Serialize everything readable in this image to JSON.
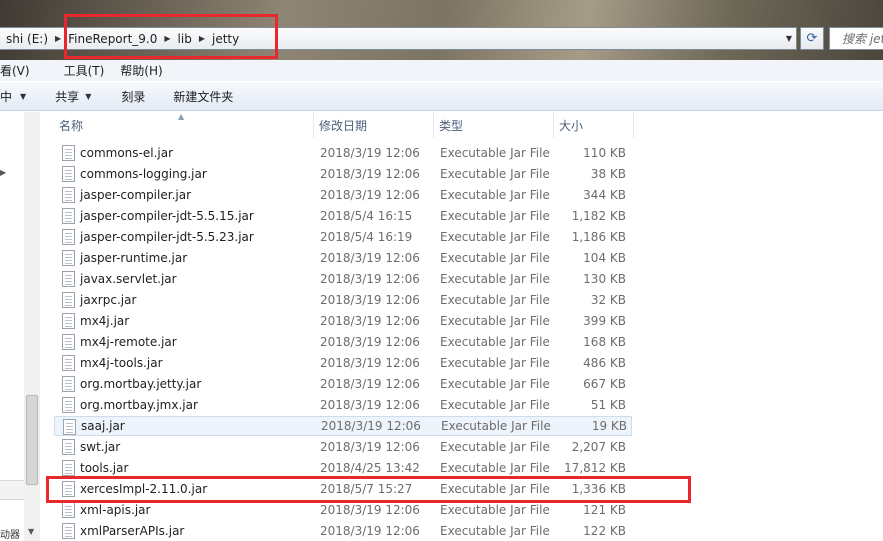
{
  "address": {
    "crumbs": [
      "shi (E:)",
      "FineReport_9.0",
      "lib",
      "jetty"
    ],
    "search_placeholder": "搜索 jet"
  },
  "menu": {
    "items": [
      "看(V)",
      "工具(T)",
      "帮助(H)"
    ]
  },
  "toolbar": {
    "items": [
      "中",
      "共享",
      "刻录",
      "新建文件夹"
    ]
  },
  "nav": {
    "bottom_text": "动器"
  },
  "columns": {
    "name": "名称",
    "date": "修改日期",
    "type": "类型",
    "size": "大小"
  },
  "files": [
    {
      "name": "commons-el.jar",
      "date": "2018/3/19 12:06",
      "type": "Executable Jar File",
      "size": "110 KB"
    },
    {
      "name": "commons-logging.jar",
      "date": "2018/3/19 12:06",
      "type": "Executable Jar File",
      "size": "38 KB"
    },
    {
      "name": "jasper-compiler.jar",
      "date": "2018/3/19 12:06",
      "type": "Executable Jar File",
      "size": "344 KB"
    },
    {
      "name": "jasper-compiler-jdt-5.5.15.jar",
      "date": "2018/5/4 16:15",
      "type": "Executable Jar File",
      "size": "1,182 KB"
    },
    {
      "name": "jasper-compiler-jdt-5.5.23.jar",
      "date": "2018/5/4 16:19",
      "type": "Executable Jar File",
      "size": "1,186 KB"
    },
    {
      "name": "jasper-runtime.jar",
      "date": "2018/3/19 12:06",
      "type": "Executable Jar File",
      "size": "104 KB"
    },
    {
      "name": "javax.servlet.jar",
      "date": "2018/3/19 12:06",
      "type": "Executable Jar File",
      "size": "130 KB"
    },
    {
      "name": "jaxrpc.jar",
      "date": "2018/3/19 12:06",
      "type": "Executable Jar File",
      "size": "32 KB"
    },
    {
      "name": "mx4j.jar",
      "date": "2018/3/19 12:06",
      "type": "Executable Jar File",
      "size": "399 KB"
    },
    {
      "name": "mx4j-remote.jar",
      "date": "2018/3/19 12:06",
      "type": "Executable Jar File",
      "size": "168 KB"
    },
    {
      "name": "mx4j-tools.jar",
      "date": "2018/3/19 12:06",
      "type": "Executable Jar File",
      "size": "486 KB"
    },
    {
      "name": "org.mortbay.jetty.jar",
      "date": "2018/3/19 12:06",
      "type": "Executable Jar File",
      "size": "667 KB"
    },
    {
      "name": "org.mortbay.jmx.jar",
      "date": "2018/3/19 12:06",
      "type": "Executable Jar File",
      "size": "51 KB"
    },
    {
      "name": "saaj.jar",
      "date": "2018/3/19 12:06",
      "type": "Executable Jar File",
      "size": "19 KB"
    },
    {
      "name": "swt.jar",
      "date": "2018/3/19 12:06",
      "type": "Executable Jar File",
      "size": "2,207 KB"
    },
    {
      "name": "tools.jar",
      "date": "2018/4/25 13:42",
      "type": "Executable Jar File",
      "size": "17,812 KB"
    },
    {
      "name": "xercesImpl-2.11.0.jar",
      "date": "2018/5/7 15:27",
      "type": "Executable Jar File",
      "size": "1,336 KB"
    },
    {
      "name": "xml-apis.jar",
      "date": "2018/3/19 12:06",
      "type": "Executable Jar File",
      "size": "121 KB"
    },
    {
      "name": "xmlParserAPIs.jar",
      "date": "2018/3/19 12:06",
      "type": "Executable Jar File",
      "size": "122 KB"
    }
  ]
}
